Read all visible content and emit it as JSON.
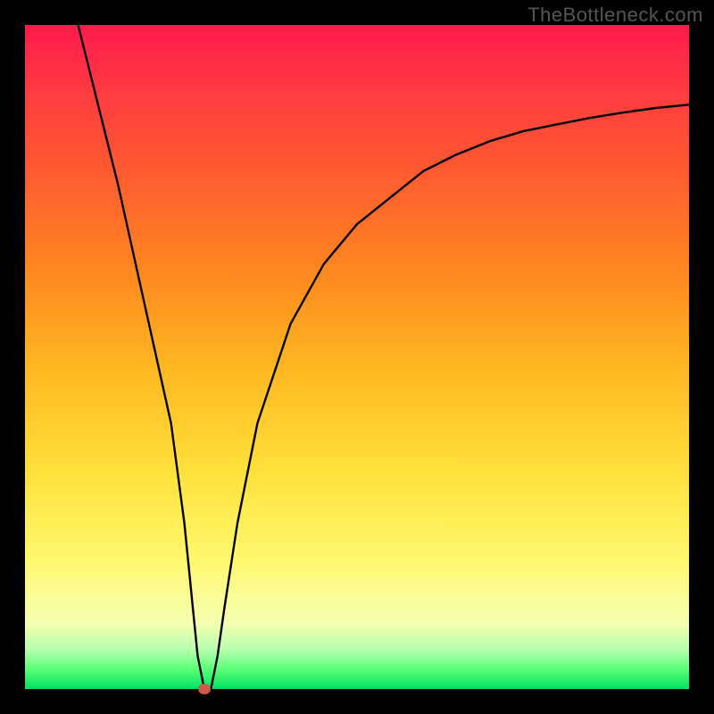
{
  "watermark": "TheBottleneck.com",
  "chart_data": {
    "type": "line",
    "title": "",
    "xlabel": "",
    "ylabel": "",
    "xlim": [
      0,
      100
    ],
    "ylim": [
      0,
      100
    ],
    "grid": false,
    "series": [
      {
        "name": "bottleneck-curve",
        "x": [
          8,
          10,
          12,
          14,
          16,
          18,
          20,
          22,
          24,
          25,
          26,
          27,
          28,
          29,
          30,
          32,
          35,
          40,
          45,
          50,
          55,
          60,
          65,
          70,
          75,
          80,
          85,
          90,
          95,
          100
        ],
        "y": [
          100,
          92,
          84,
          76,
          67,
          58,
          49,
          40,
          25,
          15,
          5,
          0,
          0,
          5,
          12,
          25,
          40,
          55,
          64,
          70,
          74,
          78,
          80.5,
          82.5,
          84,
          85,
          86,
          86.8,
          87.5,
          88
        ]
      }
    ],
    "annotations": [
      {
        "name": "optimal-point",
        "x": 27,
        "y": 0
      }
    ],
    "background_gradient": {
      "top": "#ff1a4d",
      "bottom": "#00e060"
    }
  }
}
